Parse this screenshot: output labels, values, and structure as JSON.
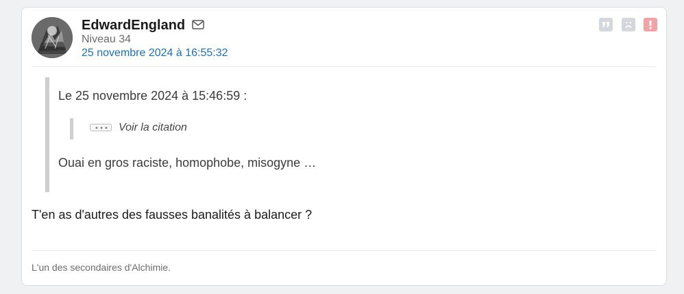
{
  "post": {
    "author": {
      "username": "EdwardEngland",
      "level": "Niveau 34",
      "avatar": "avatar-image"
    },
    "date": "25 novembre 2024 à 16:55:32",
    "actions": {
      "mail": "mail-icon",
      "quote": "quote-icon",
      "sad": "sad-face-icon",
      "report": "report-icon"
    },
    "quote": {
      "header": "Le 25 novembre 2024 à 15:46:59 :",
      "nested_label": "Voir la citation",
      "body": "Ouai en gros raciste, homophobe, misogyne …"
    },
    "message": "T'en as d'autres des fausses banalités à balancer ?",
    "signature": "L'un des secondaires d'Alchimie."
  },
  "colors": {
    "date_link": "#1a6fc2",
    "report_button": "#f2a3a3",
    "action_button": "#d4d7db",
    "quote_bar": "#cfcfcf"
  }
}
